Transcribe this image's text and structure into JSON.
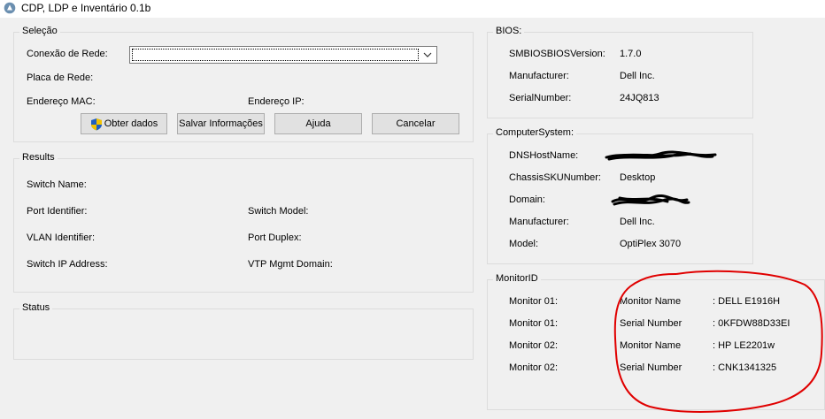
{
  "window": {
    "title": "CDP, LDP e Inventário 0.1b"
  },
  "selecao": {
    "legend": "Seleção",
    "conexao_label": "Conexão de Rede:",
    "conexao_value": "",
    "placa_label": "Placa de Rede:",
    "mac_label": "Endereço MAC:",
    "ip_label": "Endereço IP:",
    "buttons": {
      "obter": "Obter dados",
      "salvar": "Salvar Informações",
      "ajuda": "Ajuda",
      "cancelar": "Cancelar"
    }
  },
  "results": {
    "legend": "Results",
    "switch_name": "Switch Name:",
    "port_identifier": "Port Identifier:",
    "switch_model": "Switch Model:",
    "vlan_identifier": "VLAN Identifier:",
    "port_duplex": "Port Duplex:",
    "switch_ip": "Switch IP Address:",
    "vtp_domain": "VTP Mgmt Domain:"
  },
  "status": {
    "legend": "Status"
  },
  "bios": {
    "legend": "BIOS:",
    "rows": [
      {
        "label": "SMBIOSBIOSVersion:",
        "value": "1.7.0"
      },
      {
        "label": "Manufacturer:",
        "value": "Dell Inc."
      },
      {
        "label": "SerialNumber:",
        "value": "24JQ813"
      }
    ]
  },
  "computer_system": {
    "legend": "ComputerSystem:",
    "rows": [
      {
        "label": "DNSHostName:",
        "value": ""
      },
      {
        "label": "ChassisSKUNumber:",
        "value": "Desktop"
      },
      {
        "label": "Domain:",
        "value": ""
      },
      {
        "label": "Manufacturer:",
        "value": "Dell Inc."
      },
      {
        "label": "Model:",
        "value": "OptiPlex 3070"
      }
    ]
  },
  "monitor_id": {
    "legend": "MonitorID",
    "rows": [
      {
        "label": "Monitor 01:",
        "field": "Monitor Name",
        "value": ": DELL E1916H"
      },
      {
        "label": "Monitor 01:",
        "field": "Serial Number",
        "value": ": 0KFDW88D33EI"
      },
      {
        "label": "Monitor 02:",
        "field": "Monitor Name",
        "value": ": HP LE2201w"
      },
      {
        "label": "Monitor 02:",
        "field": "Serial Number",
        "value": ": CNK1341325"
      }
    ]
  },
  "colors": {
    "annotation": "#e00000",
    "redaction": "#000000",
    "shield_blue": "#1f5fc0",
    "shield_yellow": "#f2c200"
  },
  "icons": {
    "app": "app-icon",
    "combo": "chevron-down-icon",
    "shield": "uac-shield-icon"
  }
}
